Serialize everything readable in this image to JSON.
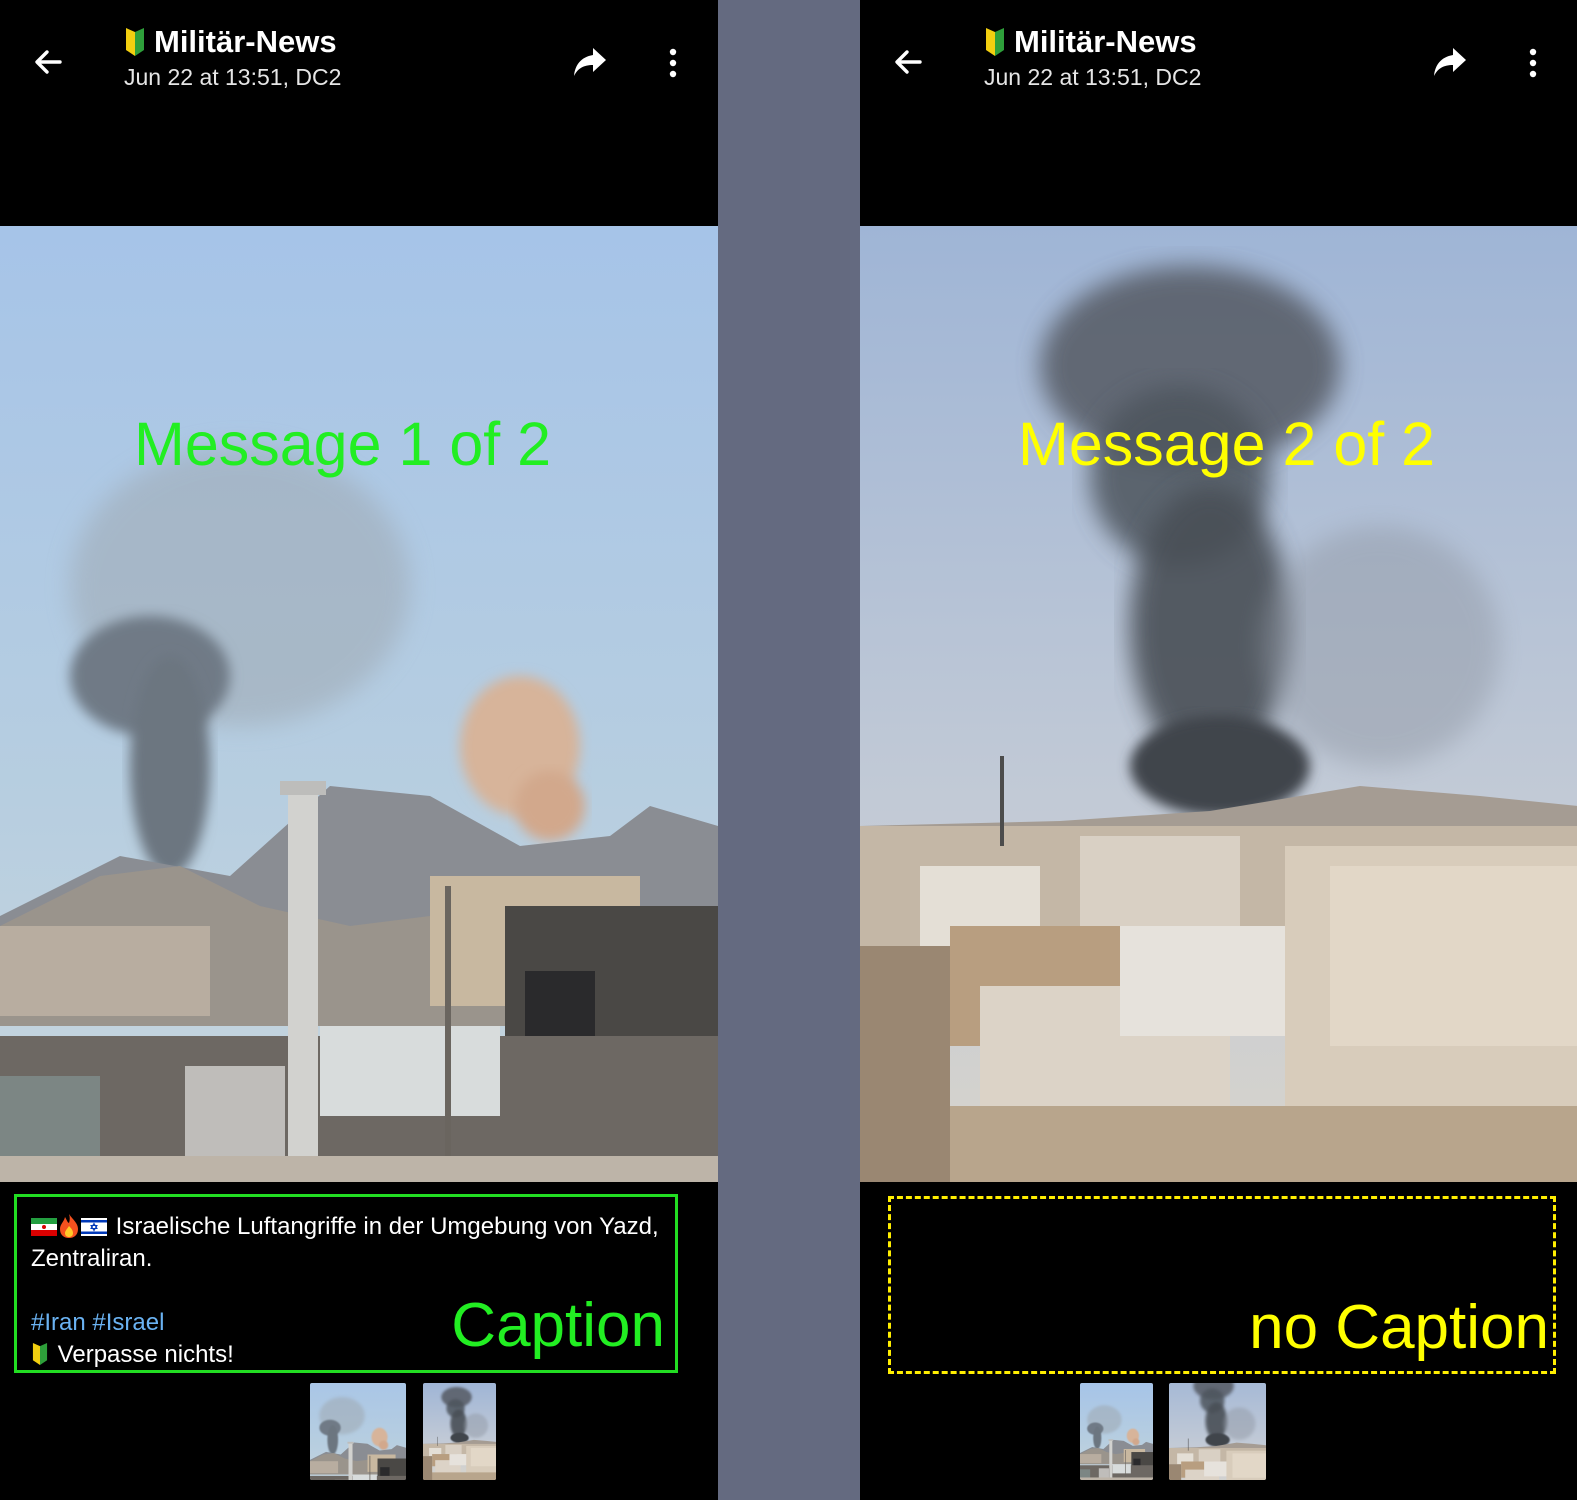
{
  "panels": [
    {
      "channel": "Militär-News",
      "timestamp": "Jun 22 at 13:51, DC2",
      "overlay_label": "Message 1 of 2",
      "caption": {
        "text": "Israelische Luftangriffe in der Umgebung von Yazd, Zentraliran.",
        "hashtags": "#Iran #Israel",
        "footer": "Verpasse nichts!"
      },
      "caption_label": "Caption"
    },
    {
      "channel": "Militär-News",
      "timestamp": "Jun 22 at 13:51, DC2",
      "overlay_label": "Message 2 of 2",
      "caption_label": "no Caption"
    }
  ],
  "colors": {
    "panel_bg": "#000000",
    "divider": "#646a80",
    "label_green": "#22ee22",
    "label_yellow": "#ffff00",
    "hashtag": "#6ab2f2"
  },
  "icons": [
    "back-arrow-icon",
    "beginner-leaf-icon",
    "share-icon",
    "more-vertical-icon",
    "flag-iran-icon",
    "fire-icon",
    "flag-israel-icon"
  ]
}
